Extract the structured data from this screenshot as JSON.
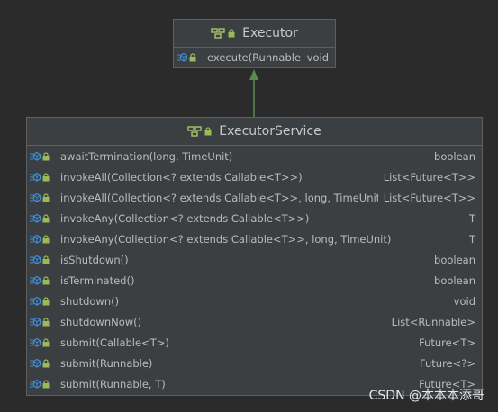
{
  "executor": {
    "title": "Executor",
    "methods": [
      {
        "signature": "execute(Runnable)",
        "return": "void"
      }
    ]
  },
  "executor_service": {
    "title": "ExecutorService",
    "methods": [
      {
        "signature": "awaitTermination(long, TimeUnit)",
        "return": "boolean"
      },
      {
        "signature": "invokeAll(Collection<? extends Callable<T>>)",
        "return": "List<Future<T>>"
      },
      {
        "signature": "invokeAll(Collection<? extends Callable<T>>, long, TimeUnit)",
        "return": "List<Future<T>>"
      },
      {
        "signature": "invokeAny(Collection<? extends Callable<T>>)",
        "return": "T"
      },
      {
        "signature": "invokeAny(Collection<? extends Callable<T>>, long, TimeUnit)",
        "return": "T"
      },
      {
        "signature": "isShutdown()",
        "return": "boolean"
      },
      {
        "signature": "isTerminated()",
        "return": "boolean"
      },
      {
        "signature": "shutdown()",
        "return": "void"
      },
      {
        "signature": "shutdownNow()",
        "return": "List<Runnable>"
      },
      {
        "signature": "submit(Callable<T>)",
        "return": "Future<T>"
      },
      {
        "signature": "submit(Runnable)",
        "return": "Future<?>"
      },
      {
        "signature": "submit(Runnable, T)",
        "return": "Future<T>"
      }
    ]
  },
  "watermark": "CSDN @本本本添哥",
  "colors": {
    "background": "#2b2b2b",
    "box": "#3c3f41",
    "arrow": "#5a8a4e",
    "interface_icon": "#a7c56a",
    "method_icon": "#3d8fd6",
    "lock": "#9aba5a"
  }
}
